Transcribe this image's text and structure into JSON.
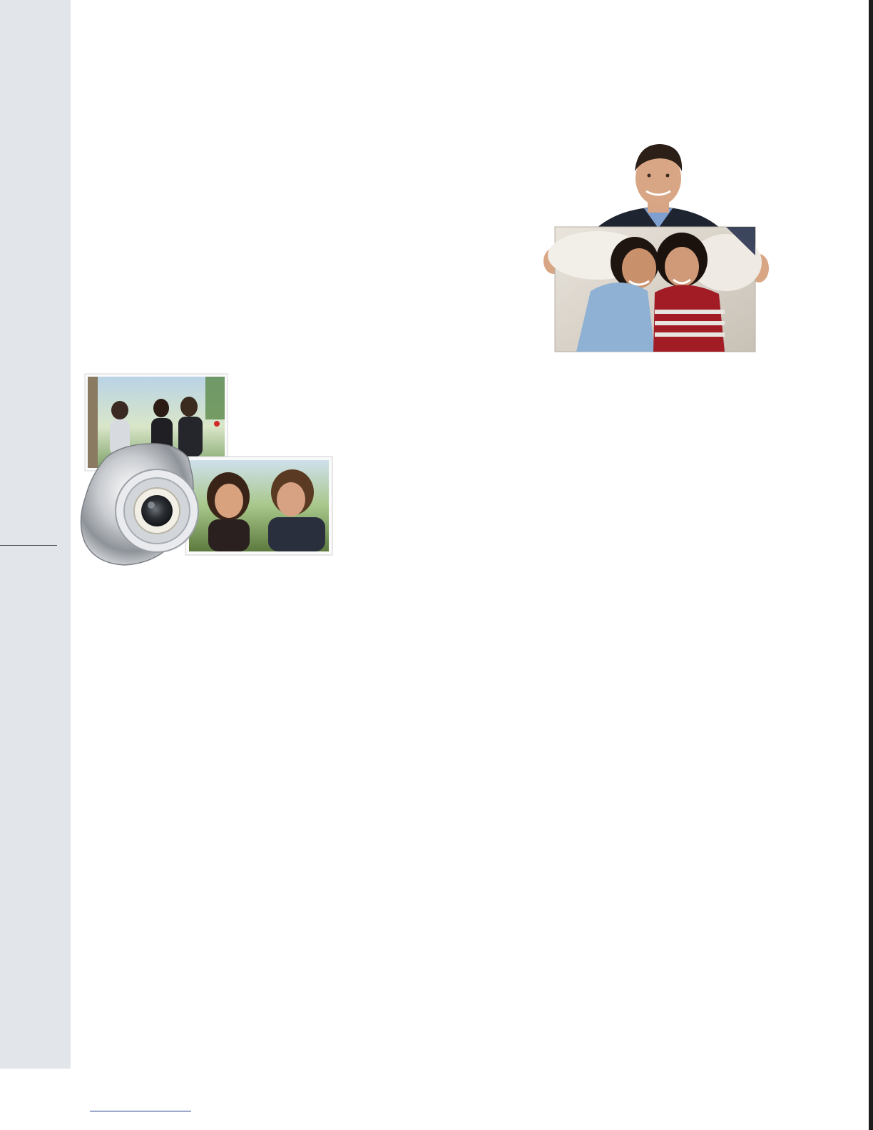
{
  "page": {
    "background": "#ffffff",
    "sidebar_color": "#e2e5ea",
    "rule_color": "#4a4a4a",
    "footer_rule_color": "#1f3a8a"
  },
  "images": {
    "camera_group": {
      "icon": "camera-with-photos-illustration"
    },
    "man_with_print": {
      "icon": "man-holding-photo-print"
    }
  }
}
